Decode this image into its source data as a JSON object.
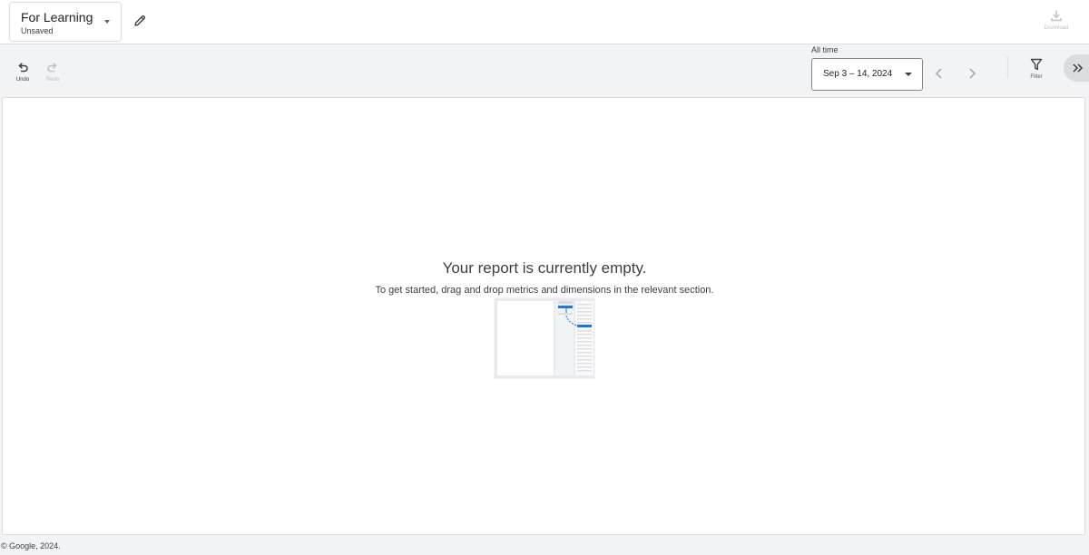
{
  "header": {
    "report_title": "For Learning",
    "report_status": "Unsaved",
    "download_label": "Download",
    "icons": {
      "report_menu": "caret-down-icon",
      "edit": "pencil-icon",
      "download": "download-icon"
    }
  },
  "toolbar": {
    "undo_label": "Undo",
    "redo_label": "Redo",
    "range_caption": "All time",
    "date_range": "Sep 3 – 14, 2024",
    "filter_label": "Filter",
    "icons": {
      "undo": "undo-icon",
      "redo": "redo-icon",
      "date_menu": "caret-down-icon",
      "previous": "chevron-left-icon",
      "next": "chevron-right-icon",
      "filter": "filter-icon",
      "expand": "double-chevron-right-icon"
    }
  },
  "canvas": {
    "empty_title": "Your report is currently empty.",
    "empty_subtitle": "To get started, drag and drop metrics and dimensions in the relevant section."
  },
  "footer": {
    "copyright": "© Google, 2024."
  },
  "colors": {
    "accent_blue": "#1a73e8",
    "background": "#f1f3f4",
    "surface": "#ffffff",
    "border": "#dadce0",
    "disabled": "#bdc1c6"
  }
}
